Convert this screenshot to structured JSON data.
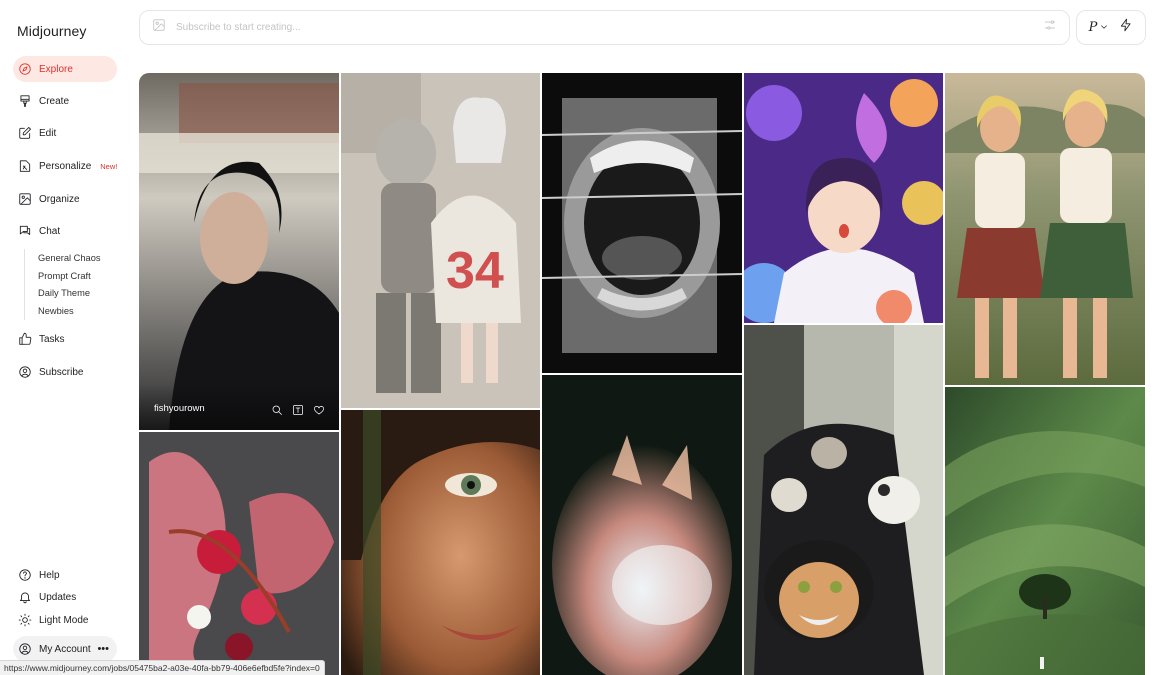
{
  "app": {
    "brand": "Midjourney"
  },
  "nav": {
    "explore": "Explore",
    "create": "Create",
    "edit": "Edit",
    "personalize": "Personalize",
    "personalize_badge": "New!",
    "organize": "Organize",
    "chat": "Chat",
    "chat_rooms": [
      "General Chaos",
      "Prompt Craft",
      "Daily Theme",
      "Newbies"
    ],
    "tasks": "Tasks",
    "subscribe": "Subscribe"
  },
  "footer_nav": {
    "help": "Help",
    "updates": "Updates",
    "light_mode": "Light Mode",
    "account": "My Account"
  },
  "search": {
    "placeholder": "Subscribe to start creating..."
  },
  "controls": {
    "profile_letter": "P"
  },
  "hovered_tile": {
    "username": "fishyourown"
  },
  "status_url": "https://www.midjourney.com/jobs/05475ba2-a03e-40fa-bb79-406e6efbd5fe?index=0",
  "colors": {
    "accent": "#e0322b",
    "active_bg": "#fde8e4"
  },
  "gallery": [
    {
      "name": "woman-black-hair-street"
    },
    {
      "name": "girl-with-robot"
    },
    {
      "name": "mouth-barbed-wire"
    },
    {
      "name": "anime-girl-bubbles"
    },
    {
      "name": "pinup-golf-girls"
    },
    {
      "name": "pink-flower-sculpture"
    },
    {
      "name": "freckled-face-closeup"
    },
    {
      "name": "glowing-fox"
    },
    {
      "name": "hooded-cats"
    },
    {
      "name": "green-hills-tree"
    }
  ]
}
